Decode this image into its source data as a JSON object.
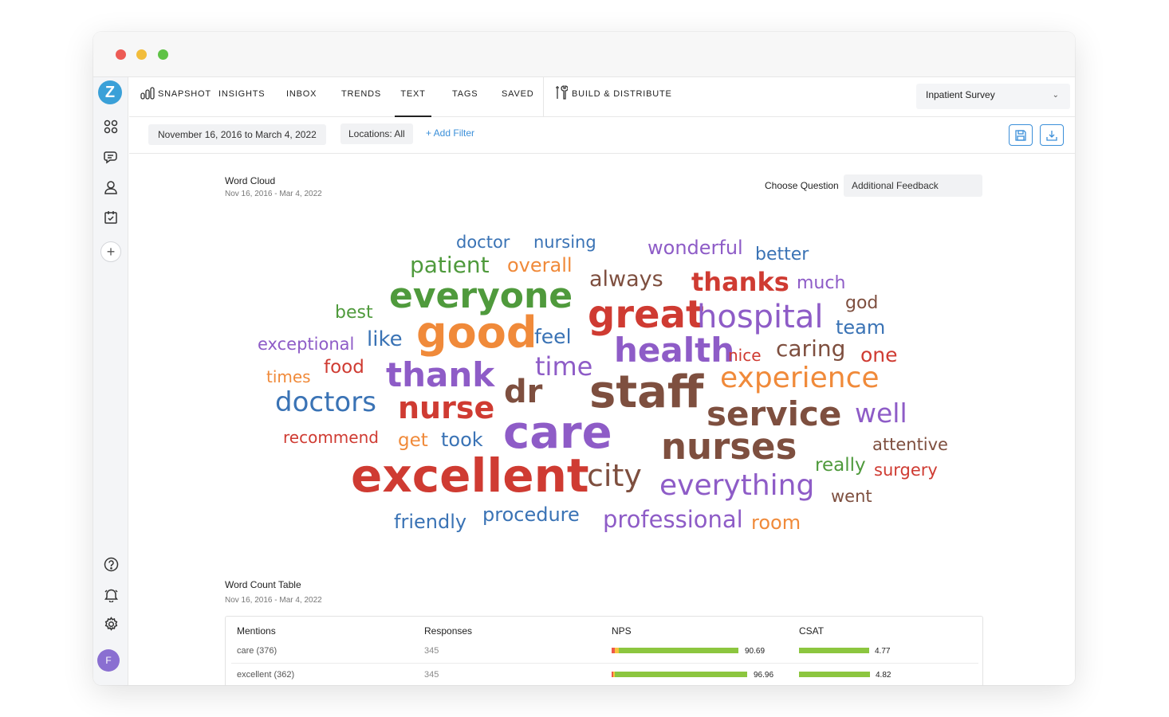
{
  "colors": {
    "accent": "#3b8fd9",
    "green": "#8cc63f",
    "orange": "#f58a3c",
    "red_segment": "#ef5a4a",
    "yellow_segment": "#f7c33d"
  },
  "sidebar": {
    "logo": "Z",
    "icons": [
      "dashboard-icon",
      "chat-icon",
      "user-icon",
      "calendar-check-icon",
      "plus-icon",
      "help-icon",
      "bell-icon",
      "gear-icon"
    ],
    "avatar": "F"
  },
  "nav": {
    "tabs": [
      {
        "label": "SNAPSHOT"
      },
      {
        "label": "INSIGHTS"
      },
      {
        "label": "INBOX"
      },
      {
        "label": "TRENDS"
      },
      {
        "label": "TEXT"
      },
      {
        "label": "TAGS"
      },
      {
        "label": "SAVED"
      }
    ],
    "build": "BUILD & DISTRIBUTE",
    "survey": "Inpatient Survey"
  },
  "filters": {
    "date_range": "November 16, 2016 to March 4, 2022",
    "locations": "Locations: All",
    "add_filter": "+ Add Filter"
  },
  "word_cloud": {
    "title": "Word Cloud",
    "date": "Nov 16, 2016 - Mar 4, 2022",
    "choose_label": "Choose Question",
    "question": "Additional Feedback",
    "words": [
      {
        "text": "doctor",
        "color": "#3a73b5"
      },
      {
        "text": "nursing",
        "color": "#3a73b5"
      },
      {
        "text": "wonderful",
        "color": "#8e5cc7"
      },
      {
        "text": "better",
        "color": "#3a73b5"
      },
      {
        "text": "patient",
        "color": "#4f9a3c"
      },
      {
        "text": "overall",
        "color": "#f08a3a"
      },
      {
        "text": "always",
        "color": "#7e4f3f"
      },
      {
        "text": "thanks",
        "color": "#cf3b32"
      },
      {
        "text": "much",
        "color": "#8e5cc7"
      },
      {
        "text": "everyone",
        "color": "#4f9a3c"
      },
      {
        "text": "best",
        "color": "#4f9a3c"
      },
      {
        "text": "great",
        "color": "#cf3b32"
      },
      {
        "text": "god",
        "color": "#7e4f3f"
      },
      {
        "text": "hospital",
        "color": "#8e5cc7"
      },
      {
        "text": "team",
        "color": "#3a73b5"
      },
      {
        "text": "exceptional",
        "color": "#8e5cc7"
      },
      {
        "text": "like",
        "color": "#3a73b5"
      },
      {
        "text": "good",
        "color": "#f08a3a"
      },
      {
        "text": "feel",
        "color": "#3a73b5"
      },
      {
        "text": "health",
        "color": "#8e5cc7"
      },
      {
        "text": "nice",
        "color": "#cf3b32"
      },
      {
        "text": "caring",
        "color": "#7e4f3f"
      },
      {
        "text": "one",
        "color": "#cf3b32"
      },
      {
        "text": "times",
        "color": "#f08a3a"
      },
      {
        "text": "food",
        "color": "#cf3b32"
      },
      {
        "text": "thank",
        "color": "#8e5cc7"
      },
      {
        "text": "time",
        "color": "#8e5cc7"
      },
      {
        "text": "experience",
        "color": "#f08a3a"
      },
      {
        "text": "dr",
        "color": "#7e4f3f"
      },
      {
        "text": "staff",
        "color": "#7e4f3f"
      },
      {
        "text": "doctors",
        "color": "#3a73b5"
      },
      {
        "text": "nurse",
        "color": "#cf3b32"
      },
      {
        "text": "service",
        "color": "#7e4f3f"
      },
      {
        "text": "well",
        "color": "#8e5cc7"
      },
      {
        "text": "recommend",
        "color": "#cf3b32"
      },
      {
        "text": "get",
        "color": "#f08a3a"
      },
      {
        "text": "took",
        "color": "#3a73b5"
      },
      {
        "text": "care",
        "color": "#8e5cc7"
      },
      {
        "text": "nurses",
        "color": "#7e4f3f"
      },
      {
        "text": "attentive",
        "color": "#7e4f3f"
      },
      {
        "text": "really",
        "color": "#4f9a3c"
      },
      {
        "text": "surgery",
        "color": "#cf3b32"
      },
      {
        "text": "excellent",
        "color": "#cf3b32"
      },
      {
        "text": "city",
        "color": "#7e4f3f"
      },
      {
        "text": "everything",
        "color": "#8e5cc7"
      },
      {
        "text": "went",
        "color": "#7e4f3f"
      },
      {
        "text": "friendly",
        "color": "#3a73b5"
      },
      {
        "text": "procedure",
        "color": "#3a73b5"
      },
      {
        "text": "professional",
        "color": "#8e5cc7"
      },
      {
        "text": "room",
        "color": "#f08a3a"
      }
    ]
  },
  "word_table": {
    "title": "Word Count Table",
    "date": "Nov 16, 2016 - Mar 4, 2022",
    "headers": [
      "Mentions",
      "Responses",
      "NPS",
      "CSAT"
    ],
    "rows": [
      {
        "mentions": "care (376)",
        "responses": "345",
        "nps": "90.69",
        "nps_value": 90.69,
        "csat": "4.77",
        "csat_value": 4.77
      },
      {
        "mentions": "excellent (362)",
        "responses": "345",
        "nps": "96.96",
        "nps_value": 96.96,
        "csat": "4.82",
        "csat_value": 4.82
      }
    ]
  }
}
